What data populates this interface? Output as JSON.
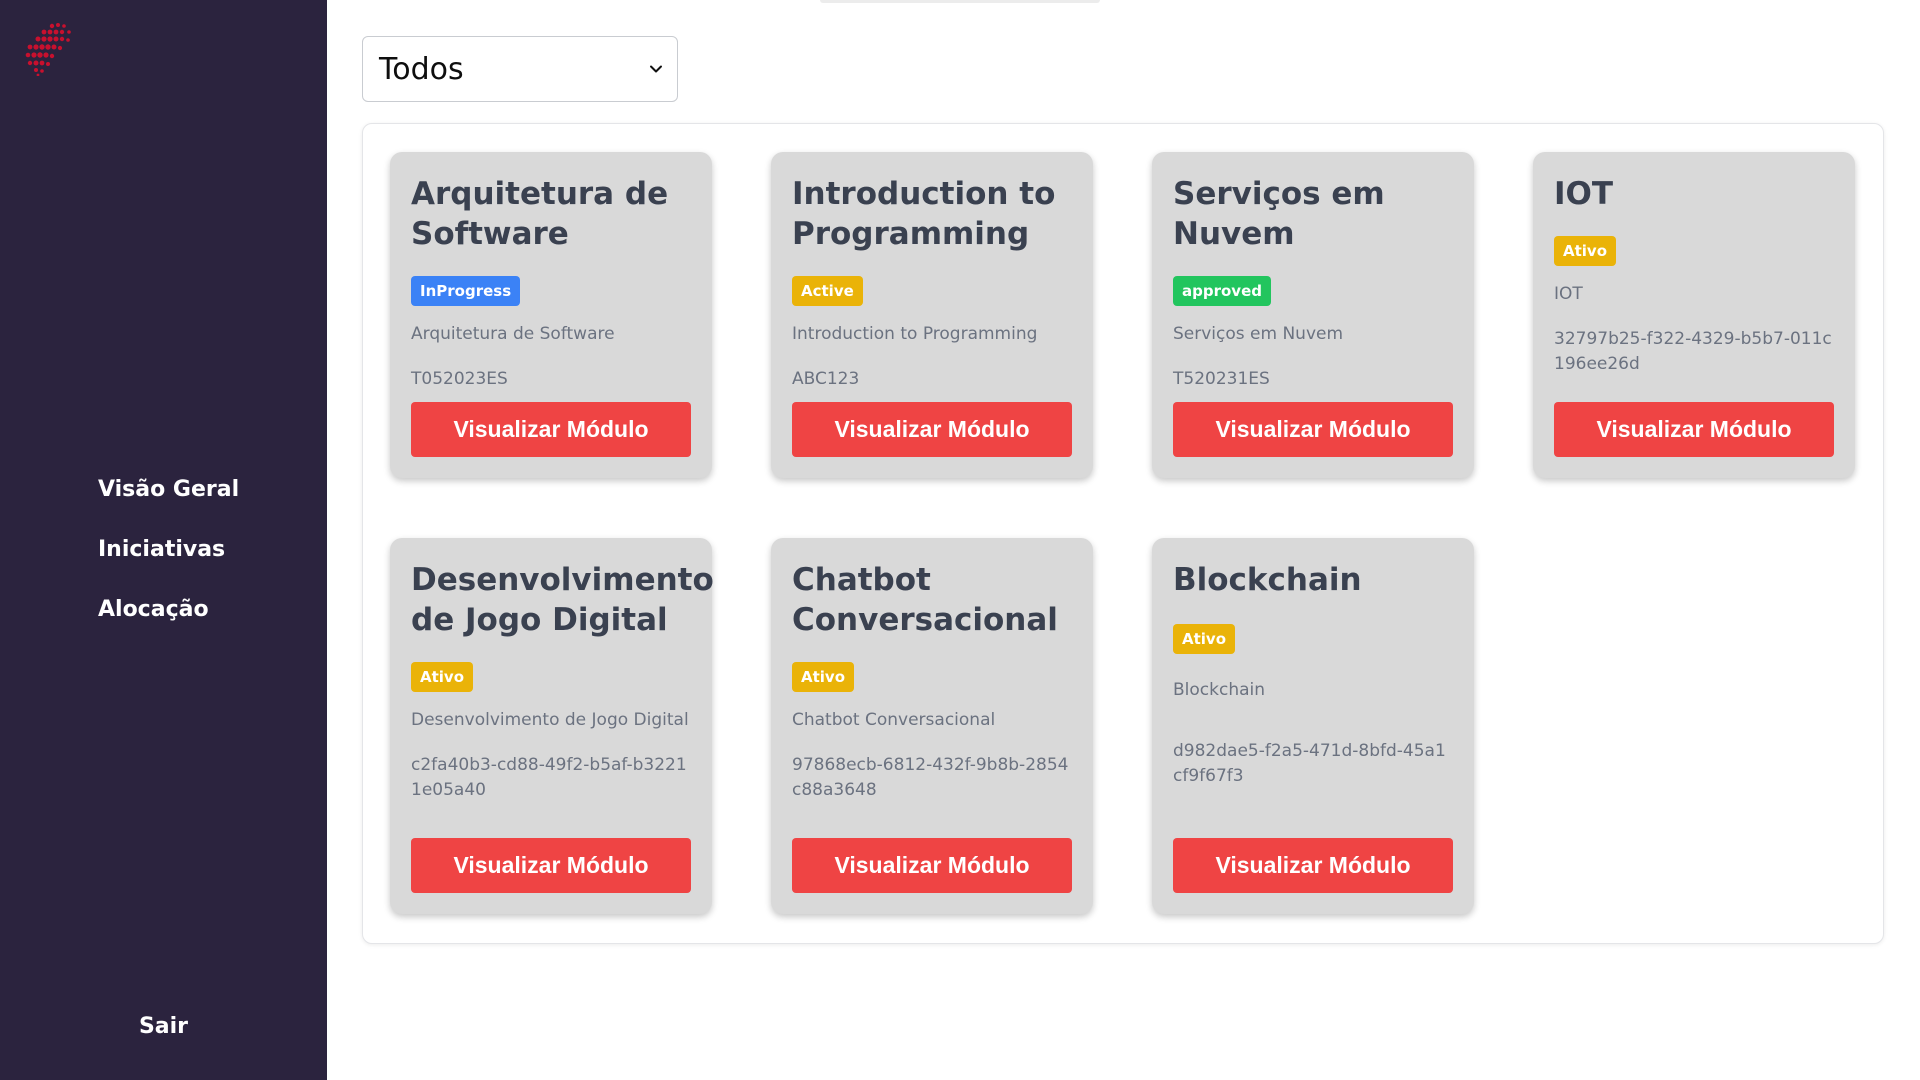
{
  "sidebar": {
    "logo_icon": "globe-dots-logo",
    "nav_items": [
      {
        "label": "Visão Geral"
      },
      {
        "label": "Iniciativas"
      },
      {
        "label": "Alocação"
      }
    ],
    "logout_label": "Sair"
  },
  "filter": {
    "selected": "Todos",
    "icon": "chevron-down-icon"
  },
  "colors": {
    "sidebar_bg": "#2b233e",
    "card_bg": "#d9d9d9",
    "button_bg": "#ef4444",
    "badge_blue": "#3b82f6",
    "badge_yellow": "#eab308",
    "badge_green": "#22c55e"
  },
  "cards": [
    {
      "title": "Arquitetura de Software",
      "status": "InProgress",
      "status_color": "blue",
      "description": "Arquitetura de Software",
      "code": "T052023ES",
      "button_label": "Visualizar Módulo"
    },
    {
      "title": "Introduction to Programming",
      "status": "Active",
      "status_color": "yellow",
      "description": "Introduction to Programming",
      "code": "ABC123",
      "button_label": "Visualizar Módulo"
    },
    {
      "title": "Serviços em Nuvem",
      "status": "approved",
      "status_color": "green",
      "description": "Serviços em Nuvem",
      "code": "T520231ES",
      "button_label": "Visualizar Módulo"
    },
    {
      "title": "IOT",
      "status": "Ativo",
      "status_color": "yellow",
      "description": "IOT",
      "code": "32797b25-f322-4329-b5b7-011c196ee26d",
      "button_label": "Visualizar Módulo"
    },
    {
      "title": "Desenvolvimento de Jogo Digital",
      "status": "Ativo",
      "status_color": "yellow",
      "description": "Desenvolvimento de Jogo Digital",
      "code": "c2fa40b3-cd88-49f2-b5af-b32211e05a40",
      "button_label": "Visualizar Módulo"
    },
    {
      "title": "Chatbot Conversacional",
      "status": "Ativo",
      "status_color": "yellow",
      "description": "Chatbot Conversacional",
      "code": "97868ecb-6812-432f-9b8b-2854c88a3648",
      "button_label": "Visualizar Módulo"
    },
    {
      "title": "Blockchain",
      "status": "Ativo",
      "status_color": "yellow",
      "description": "Blockchain",
      "code": "d982dae5-f2a5-471d-8bfd-45a1cf9f67f3",
      "button_label": "Visualizar Módulo"
    }
  ]
}
